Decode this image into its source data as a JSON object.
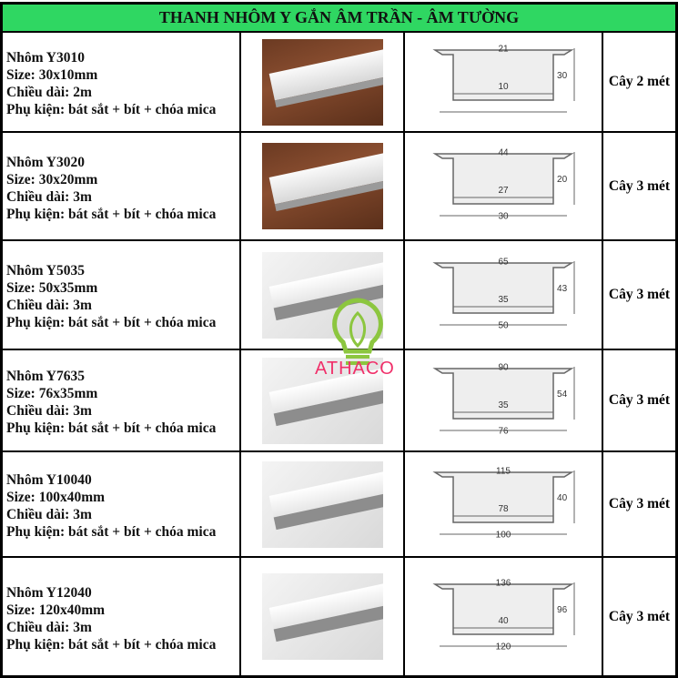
{
  "title": "THANH NHÔM Y GẮN ÂM TRẦN - ÂM TƯỜNG",
  "rows": [
    {
      "name": "Nhôm Y3010",
      "size": "Size: 30x10mm",
      "length": "Chiều dài: 2m",
      "accessories": "Phụ kiện: bát sắt + bít + chóa mica",
      "dims": [
        "21",
        "10",
        "30"
      ],
      "unit": "Cây 2 mét"
    },
    {
      "name": "Nhôm Y3020",
      "size": "Size: 30x20mm",
      "length": "Chiều dài: 3m",
      "accessories": "Phụ kiện: bát sắt + bít + chóa mica",
      "dims": [
        "44",
        "27",
        "20",
        "30"
      ],
      "unit": "Cây 3 mét"
    },
    {
      "name": "Nhôm Y5035",
      "size": "Size: 50x35mm",
      "length": "Chiều dài: 3m",
      "accessories": "Phụ kiện: bát sắt + bít + chóa mica",
      "dims": [
        "65",
        "35",
        "43",
        "50"
      ],
      "unit": "Cây 3 mét"
    },
    {
      "name": "Nhôm Y7635",
      "size": "Size: 76x35mm",
      "length": "Chiều dài: 3m",
      "accessories": "Phụ kiện: bát sắt + bít + chóa mica",
      "dims": [
        "90",
        "35",
        "54",
        "76"
      ],
      "unit": "Cây 3 mét"
    },
    {
      "name": "Nhôm Y10040",
      "size": "Size: 100x40mm",
      "length": "Chiều dài: 3m",
      "accessories": "Phụ kiện: bát sắt + bít + chóa mica",
      "dims": [
        "115",
        "78",
        "40",
        "100"
      ],
      "unit": "Cây 3 mét"
    },
    {
      "name": "Nhôm Y12040",
      "size": "Size: 120x40mm",
      "length": "Chiều dài: 3m",
      "accessories": "Phụ kiện: bát sắt + bít + chóa mica",
      "dims": [
        "136",
        "40",
        "96",
        "120"
      ],
      "unit": "Cây 3 mét"
    }
  ],
  "watermark": "ATHACO",
  "colors": {
    "header": "#2fd762",
    "logo_green": "#8cc63f",
    "logo_pink": "#f0306a"
  }
}
